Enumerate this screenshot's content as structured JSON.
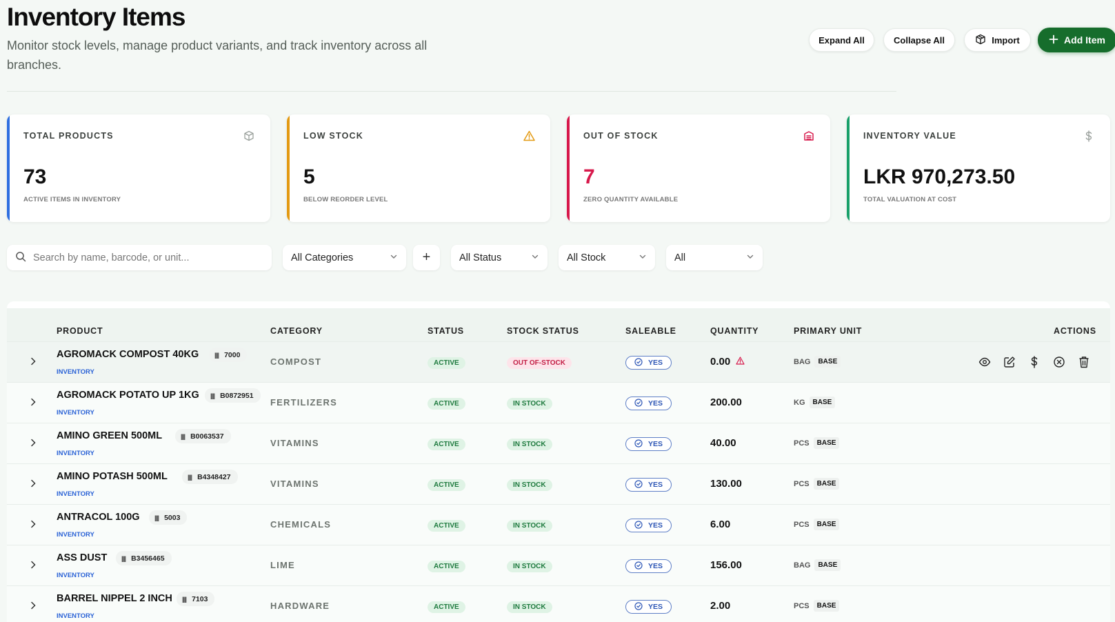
{
  "header": {
    "title": "Inventory Items",
    "subtitle": "Monitor stock levels, manage product variants, and track inventory across all branches.",
    "buttons": {
      "expand_all": "Expand All",
      "collapse_all": "Collapse All",
      "import": "Import",
      "add_item": "Add Item"
    },
    "icons": {
      "import": "box-icon",
      "add": "plus-icon"
    }
  },
  "stats": [
    {
      "label": "TOTAL PRODUCTS",
      "value": "73",
      "caption": "ACTIVE ITEMS IN INVENTORY",
      "icon": "box-icon",
      "accent": "#2f6fe0",
      "value_color": "#111111"
    },
    {
      "label": "LOW STOCK",
      "value": "5",
      "caption": "BELOW REORDER LEVEL",
      "icon": "warning-icon",
      "accent": "#e39a13",
      "value_color": "#111111"
    },
    {
      "label": "OUT OF STOCK",
      "value": "7",
      "caption": "ZERO QUANTITY AVAILABLE",
      "icon": "archive-icon",
      "accent": "#d7184b",
      "value_color": "#d7184b"
    },
    {
      "label": "INVENTORY VALUE",
      "value": "LKR 970,273.50",
      "caption": "TOTAL VALUATION AT COST",
      "icon": "dollar-icon",
      "accent": "#19a06a",
      "value_color": "#111111"
    }
  ],
  "filters": {
    "search_placeholder": "Search by name, barcode, or unit...",
    "category": "All Categories",
    "add_category": "+",
    "status": "All Status",
    "stock": "All Stock",
    "type": "All"
  },
  "table": {
    "columns": {
      "product": "PRODUCT",
      "category": "CATEGORY",
      "status": "STATUS",
      "stock_status": "STOCK STATUS",
      "saleable": "SALEABLE",
      "quantity": "QUANTITY",
      "primary_unit": "PRIMARY UNIT",
      "actions": "ACTIONS"
    },
    "rows": [
      {
        "name": "AGROMACK COMPOST 40KG",
        "barcode": "7000",
        "type": "INVENTORY",
        "category": "COMPOST",
        "status": "ACTIVE",
        "stock_status": "OUT OF-STOCK",
        "saleable": "YES",
        "quantity": "0.00",
        "unit": "BAG",
        "unit_tag": "BASE"
      },
      {
        "name": "AGROMACK POTATO UP 1KG",
        "barcode": "B0872951",
        "type": "INVENTORY",
        "category": "FERTILIZERS",
        "status": "ACTIVE",
        "stock_status": "IN STOCK",
        "saleable": "YES",
        "quantity": "200.00",
        "unit": "KG",
        "unit_tag": "BASE"
      },
      {
        "name": "AMINO GREEN 500ML",
        "barcode": "B0063537",
        "type": "INVENTORY",
        "category": "VITAMINS",
        "status": "ACTIVE",
        "stock_status": "IN STOCK",
        "saleable": "YES",
        "quantity": "40.00",
        "unit": "PCS",
        "unit_tag": "BASE"
      },
      {
        "name": "AMINO POTASH 500ML",
        "barcode": "B4348427",
        "type": "INVENTORY",
        "category": "VITAMINS",
        "status": "ACTIVE",
        "stock_status": "IN STOCK",
        "saleable": "YES",
        "quantity": "130.00",
        "unit": "PCS",
        "unit_tag": "BASE"
      },
      {
        "name": "ANTRACOL 100G",
        "barcode": "5003",
        "type": "INVENTORY",
        "category": "CHEMICALS",
        "status": "ACTIVE",
        "stock_status": "IN STOCK",
        "saleable": "YES",
        "quantity": "6.00",
        "unit": "PCS",
        "unit_tag": "BASE"
      },
      {
        "name": "ASS DUST",
        "barcode": "B3456465",
        "type": "INVENTORY",
        "category": "LIME",
        "status": "ACTIVE",
        "stock_status": "IN STOCK",
        "saleable": "YES",
        "quantity": "156.00",
        "unit": "BAG",
        "unit_tag": "BASE"
      },
      {
        "name": "BARREL NIPPEL 2 INCH",
        "barcode": "7103",
        "type": "INVENTORY",
        "category": "HARDWARE",
        "status": "ACTIVE",
        "stock_status": "IN STOCK",
        "saleable": "YES",
        "quantity": "2.00",
        "unit": "PCS",
        "unit_tag": "BASE"
      }
    ],
    "row_actions": [
      "eye-icon",
      "edit-icon",
      "dollar-icon",
      "deactivate-icon",
      "trash-icon"
    ]
  }
}
